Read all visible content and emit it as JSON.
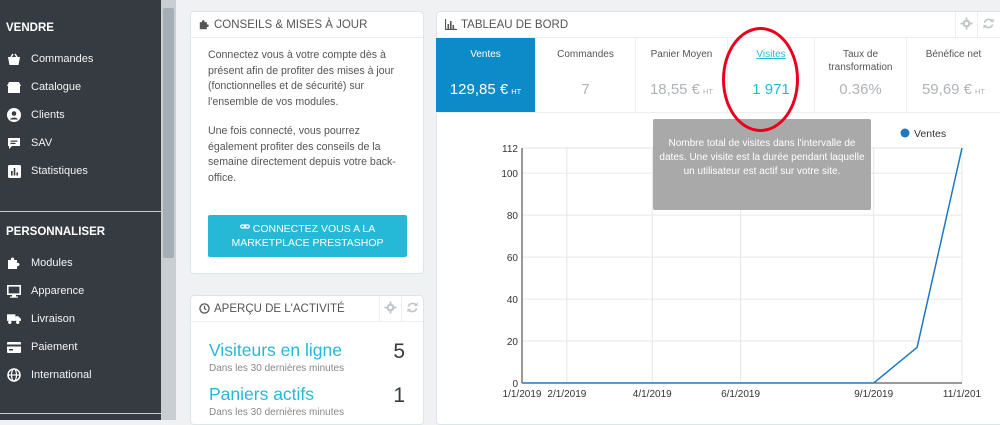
{
  "sidebar": {
    "sections": [
      {
        "title": "VENDRE",
        "items": [
          {
            "label": "Commandes",
            "icon": "basket-icon"
          },
          {
            "label": "Catalogue",
            "icon": "store-icon"
          },
          {
            "label": "Clients",
            "icon": "user-icon"
          },
          {
            "label": "SAV",
            "icon": "chat-icon"
          },
          {
            "label": "Statistiques",
            "icon": "stats-icon"
          }
        ]
      },
      {
        "title": "PERSONNALISER",
        "items": [
          {
            "label": "Modules",
            "icon": "puzzle-icon"
          },
          {
            "label": "Apparence",
            "icon": "monitor-icon"
          },
          {
            "label": "Livraison",
            "icon": "truck-icon"
          },
          {
            "label": "Paiement",
            "icon": "card-icon"
          },
          {
            "label": "International",
            "icon": "globe-icon"
          }
        ]
      }
    ]
  },
  "conseils": {
    "title": "CONSEILS & MISES À JOUR",
    "para1": "Connectez vous à votre compte dès à présent afin de profiter des mises à jour (fonctionnelles et de sécurité) sur l'ensemble de vos modules.",
    "para2": "Une fois connecté, vous pourrez également profiter des conseils de la semaine directement depuis votre back-office.",
    "button_line1": "CONNECTEZ VOUS A LA",
    "button_line2": "MARKETPLACE PRESTASHOP"
  },
  "activity": {
    "title": "APERÇU DE L'ACTIVITÉ",
    "stats": [
      {
        "label": "Visiteurs en ligne",
        "sub": "Dans les 30 dernières minutes",
        "value": "5"
      },
      {
        "label": "Paniers actifs",
        "sub": "Dans les 30 dernières minutes",
        "value": "1"
      }
    ]
  },
  "dashboard": {
    "title": "TABLEAU DE BORD",
    "kpis": [
      {
        "label": "Ventes",
        "value": "129,85 €",
        "unit": "HT"
      },
      {
        "label": "Commandes",
        "value": "7",
        "unit": ""
      },
      {
        "label": "Panier Moyen",
        "value": "18,55 €",
        "unit": "HT"
      },
      {
        "label": "Visites",
        "value": "1 971",
        "unit": ""
      },
      {
        "label": "Taux de transformation",
        "value": "0.36%",
        "unit": ""
      },
      {
        "label": "Bénéfice net",
        "value": "59,69 €",
        "unit": "HT"
      }
    ],
    "tooltip": "Nombre total de visites dans l'intervalle de dates. Une visite est la durée pendant laquelle un utilisateur est actif sur votre site."
  },
  "colors": {
    "sidebar_bg": "#363a41",
    "accent": "#25b9d7",
    "active_kpi": "#0c8bc8",
    "series": "#1f78c1",
    "highlight_circle": "#e8001d"
  },
  "chart_data": {
    "type": "line",
    "x_ticks": [
      "1/1/2019",
      "2/1/2019",
      "4/1/2019",
      "6/1/2019",
      "9/1/2019",
      "11/1/201"
    ],
    "y_ticks": [
      0,
      20,
      40,
      60,
      80,
      100,
      112
    ],
    "ylim": [
      0,
      112
    ],
    "grid": true,
    "legend": "top-right",
    "series": [
      {
        "name": "Ventes",
        "x": [
          "2019-01-01",
          "2019-09-01",
          "2019-10-01",
          "2019-11-01"
        ],
        "y": [
          0,
          0,
          17,
          112
        ]
      }
    ]
  }
}
